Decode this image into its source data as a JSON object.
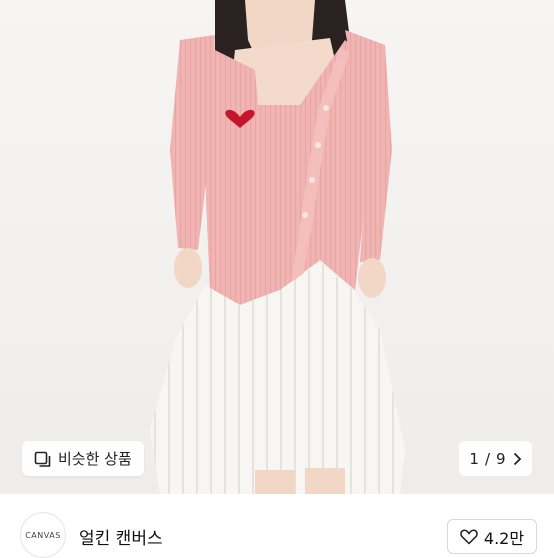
{
  "product_image": {
    "similar_button_label": "비슷한 상품",
    "pager": {
      "current": "1",
      "separator": "/",
      "total": "9"
    }
  },
  "shop": {
    "logo_text": "CANVAS",
    "name": "얼킨 캔버스",
    "likes": "4.2만"
  },
  "icons": [
    "similar-products-icon",
    "chevron-right-icon",
    "heart-outline-icon"
  ]
}
